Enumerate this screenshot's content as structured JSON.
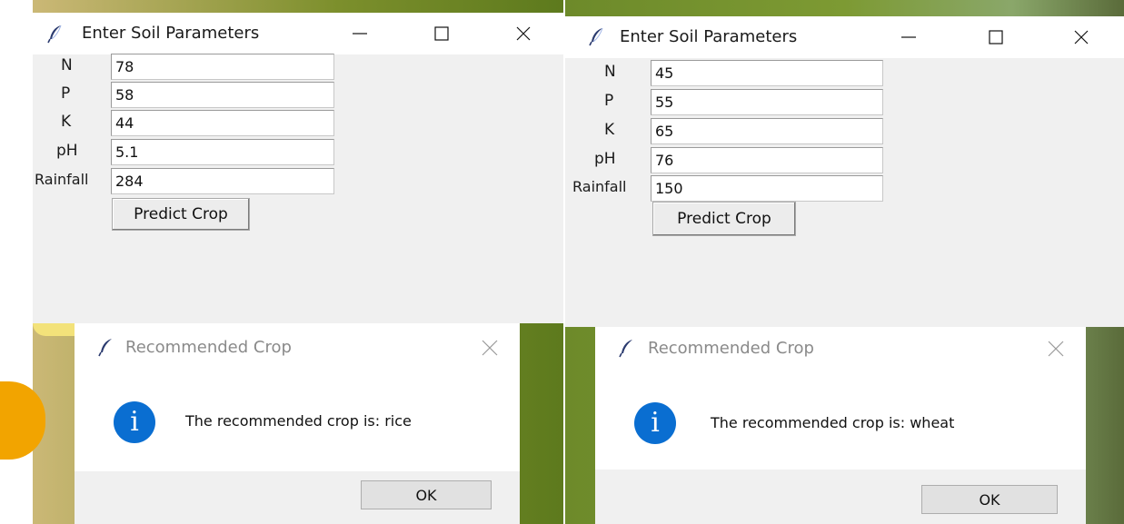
{
  "left": {
    "window": {
      "title": "Enter Soil Parameters",
      "fields": [
        {
          "label": "N",
          "value": "78"
        },
        {
          "label": "P",
          "value": "58"
        },
        {
          "label": "K",
          "value": "44"
        },
        {
          "label": "pH",
          "value": "5.1"
        },
        {
          "label": "Rainfall",
          "value": "284"
        }
      ],
      "button_label": "Predict Crop"
    },
    "dialog": {
      "title": "Recommended Crop",
      "message": "The recommended crop is: rice",
      "ok_label": "OK"
    }
  },
  "right": {
    "window": {
      "title": "Enter Soil Parameters",
      "fields": [
        {
          "label": "N",
          "value": "45"
        },
        {
          "label": "P",
          "value": "55"
        },
        {
          "label": "K",
          "value": "65"
        },
        {
          "label": "pH",
          "value": "76"
        },
        {
          "label": "Rainfall",
          "value": "150"
        }
      ],
      "button_label": "Predict Crop"
    },
    "dialog": {
      "title": "Recommended Crop",
      "message": "The recommended crop is: wheat",
      "ok_label": "OK"
    }
  },
  "icons": {
    "app": "feather-icon",
    "minimize": "minimize-icon",
    "maximize": "maximize-icon",
    "close": "close-icon",
    "info": "info-icon"
  },
  "colors": {
    "info_blue": "#0a6ed1",
    "window_bg": "#f0f0f0"
  }
}
